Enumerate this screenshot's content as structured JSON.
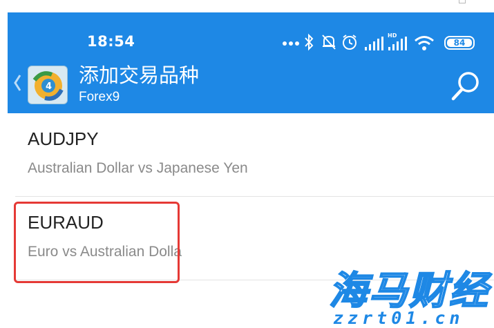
{
  "status_bar": {
    "time": "18:54",
    "battery_level": "84"
  },
  "app_bar": {
    "title": "添加交易品种",
    "subtitle": "Forex9"
  },
  "symbols": [
    {
      "name": "AUDJPY",
      "description": "Australian Dollar vs Japanese Yen"
    },
    {
      "name": "EURAUD",
      "description": "Euro vs Australian Dolla"
    }
  ],
  "watermark": {
    "brand": "海马财经",
    "url": "zzrt01.cn"
  },
  "colors": {
    "header_bg": "#1e88e5",
    "highlight": "#e53935"
  }
}
